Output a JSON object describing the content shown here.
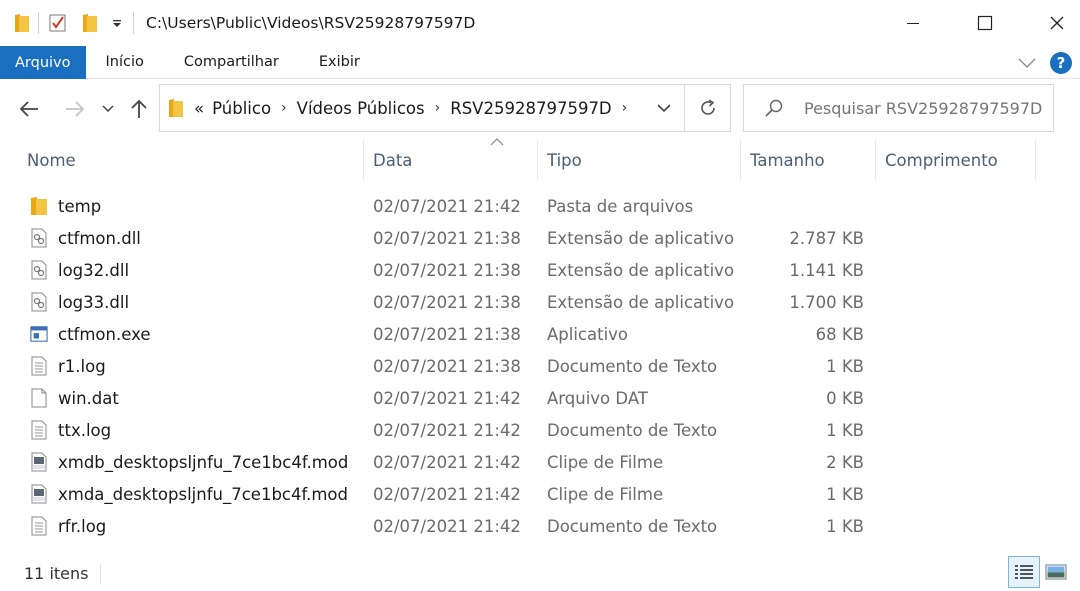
{
  "window": {
    "title": "C:\\Users\\Public\\Videos\\RSV25928797597D"
  },
  "ribbon": {
    "tabs": [
      "Arquivo",
      "Início",
      "Compartilhar",
      "Exibir"
    ],
    "help": "?"
  },
  "address": {
    "overflow": "«",
    "crumbs": [
      "Público",
      "Vídeos Públicos",
      "RSV25928797597D"
    ]
  },
  "search": {
    "placeholder": "Pesquisar RSV25928797597D"
  },
  "columns": {
    "name": "Nome",
    "date": "Data",
    "type": "Tipo",
    "size": "Tamanho",
    "length": "Comprimento"
  },
  "files": [
    {
      "name": "temp",
      "date": "02/07/2021 21:42",
      "type": "Pasta de arquivos",
      "size": "",
      "icon": "folder-icon"
    },
    {
      "name": "ctfmon.dll",
      "date": "02/07/2021 21:38",
      "type": "Extensão de aplicativo",
      "size": "2.787 KB",
      "icon": "dll-file-icon"
    },
    {
      "name": "log32.dll",
      "date": "02/07/2021 21:38",
      "type": "Extensão de aplicativo",
      "size": "1.141 KB",
      "icon": "dll-file-icon"
    },
    {
      "name": "log33.dll",
      "date": "02/07/2021 21:38",
      "type": "Extensão de aplicativo",
      "size": "1.700 KB",
      "icon": "dll-file-icon"
    },
    {
      "name": "ctfmon.exe",
      "date": "02/07/2021 21:38",
      "type": "Aplicativo",
      "size": "68 KB",
      "icon": "exe-file-icon"
    },
    {
      "name": "r1.log",
      "date": "02/07/2021 21:38",
      "type": "Documento de Texto",
      "size": "1 KB",
      "icon": "text-file-icon"
    },
    {
      "name": "win.dat",
      "date": "02/07/2021 21:42",
      "type": "Arquivo DAT",
      "size": "0 KB",
      "icon": "blank-file-icon"
    },
    {
      "name": "ttx.log",
      "date": "02/07/2021 21:42",
      "type": "Documento de Texto",
      "size": "1 KB",
      "icon": "text-file-icon"
    },
    {
      "name": "xmdb_desktopsljnfu_7ce1bc4f.mod",
      "date": "02/07/2021 21:42",
      "type": "Clipe de Filme",
      "size": "2 KB",
      "icon": "mpeg-file-icon"
    },
    {
      "name": "xmda_desktopsljnfu_7ce1bc4f.mod",
      "date": "02/07/2021 21:42",
      "type": "Clipe de Filme",
      "size": "1 KB",
      "icon": "mpeg-file-icon"
    },
    {
      "name": "rfr.log",
      "date": "02/07/2021 21:42",
      "type": "Documento de Texto",
      "size": "1 KB",
      "icon": "text-file-icon"
    }
  ],
  "status": {
    "item_count": "11 itens"
  },
  "colors": {
    "accent": "#1a6fc0",
    "folder": "#f4c542",
    "header_text": "#4a5e76"
  }
}
